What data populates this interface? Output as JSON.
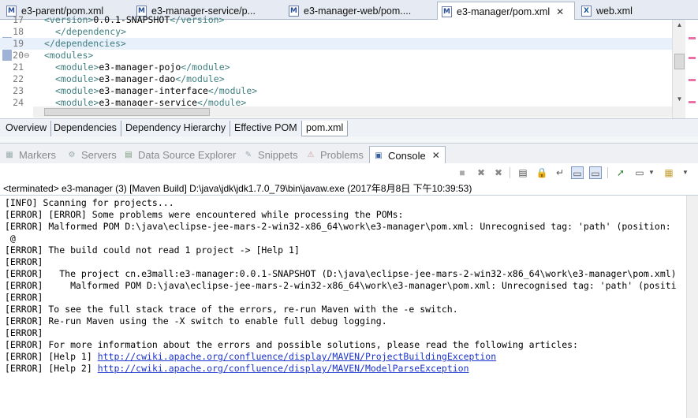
{
  "editor_tabs": [
    {
      "icon": "M",
      "label": "e3-parent/pom.xml"
    },
    {
      "icon": "M",
      "label": "e3-manager-service/p..."
    },
    {
      "icon": "M",
      "label": "e3-manager-web/pom...."
    },
    {
      "icon": "M",
      "label": "e3-manager/pom.xml",
      "active": true
    },
    {
      "icon": "X",
      "label": "web.xml"
    }
  ],
  "code_lines": [
    {
      "num": "17",
      "indent": "      ",
      "parts": [
        "<version>",
        "0.0.1-SNAPSHOT",
        "</version>"
      ]
    },
    {
      "num": "18",
      "indent": "    ",
      "parts": [
        "</dependency>",
        "",
        ""
      ]
    },
    {
      "num": "19",
      "indent": "  ",
      "parts": [
        "</dependencies>",
        "",
        ""
      ]
    },
    {
      "num": "20",
      "indent": "  ",
      "parts": [
        "<modules>",
        "",
        ""
      ],
      "fold": "⊖"
    },
    {
      "num": "21",
      "indent": "    ",
      "parts": [
        "<module>",
        "e3-manager-pojo",
        "</module>"
      ]
    },
    {
      "num": "22",
      "indent": "    ",
      "parts": [
        "<module>",
        "e3-manager-dao",
        "</module>"
      ]
    },
    {
      "num": "23",
      "indent": "    ",
      "parts": [
        "<module>",
        "e3-manager-interface",
        "</module>"
      ]
    },
    {
      "num": "24",
      "indent": "    ",
      "parts": [
        "<module>",
        "e3-manager-service",
        "</module>"
      ]
    }
  ],
  "pom_tabs": [
    {
      "label": "Overview"
    },
    {
      "label": "Dependencies"
    },
    {
      "label": "Dependency Hierarchy"
    },
    {
      "label": "Effective POM"
    },
    {
      "label": "pom.xml",
      "active": true
    }
  ],
  "panel_tabs": [
    {
      "icon": "markers-icon",
      "label": "Markers"
    },
    {
      "icon": "servers-icon",
      "label": "Servers"
    },
    {
      "icon": "data-source-explorer-icon",
      "label": "Data Source Explorer"
    },
    {
      "icon": "snippets-icon",
      "label": "Snippets"
    },
    {
      "icon": "problems-icon",
      "label": "Problems"
    },
    {
      "icon": "console-icon",
      "label": "Console",
      "active": true
    }
  ],
  "console": {
    "status": "<terminated> e3-manager (3) [Maven Build] D:\\java\\jdk\\jdk1.7.0_79\\bin\\javaw.exe (2017年8月8日 下午10:39:53)",
    "lines": [
      {
        "text": "[INFO] Scanning for projects..."
      },
      {
        "text": "[ERROR] [ERROR] Some problems were encountered while processing the POMs:"
      },
      {
        "text": "[ERROR] Malformed POM D:\\java\\eclipse-jee-mars-2-win32-x86_64\\work\\e3-manager\\pom.xml: Unrecognised tag: 'path' (position:"
      },
      {
        "text": " @"
      },
      {
        "text": "[ERROR] The build could not read 1 project -> [Help 1]"
      },
      {
        "text": "[ERROR]"
      },
      {
        "text": "[ERROR]   The project cn.e3mall:e3-manager:0.0.1-SNAPSHOT (D:\\java\\eclipse-jee-mars-2-win32-x86_64\\work\\e3-manager\\pom.xml)"
      },
      {
        "text": "[ERROR]     Malformed POM D:\\java\\eclipse-jee-mars-2-win32-x86_64\\work\\e3-manager\\pom.xml: Unrecognised tag: 'path' (positi"
      },
      {
        "text": "[ERROR]"
      },
      {
        "text": "[ERROR] To see the full stack trace of the errors, re-run Maven with the -e switch."
      },
      {
        "text": "[ERROR] Re-run Maven using the -X switch to enable full debug logging."
      },
      {
        "text": "[ERROR]"
      },
      {
        "text": "[ERROR] For more information about the errors and possible solutions, please read the following articles:"
      },
      {
        "text": "[ERROR] [Help 1] ",
        "link": "http://cwiki.apache.org/confluence/display/MAVEN/ProjectBuildingException"
      },
      {
        "text": "[ERROR] [Help 2] ",
        "link": "http://cwiki.apache.org/confluence/display/MAVEN/ModelParseException"
      }
    ]
  },
  "colors": {
    "tag": "#3f7f7f",
    "link": "#1a33cc",
    "active_line": "#e8f0fb"
  }
}
